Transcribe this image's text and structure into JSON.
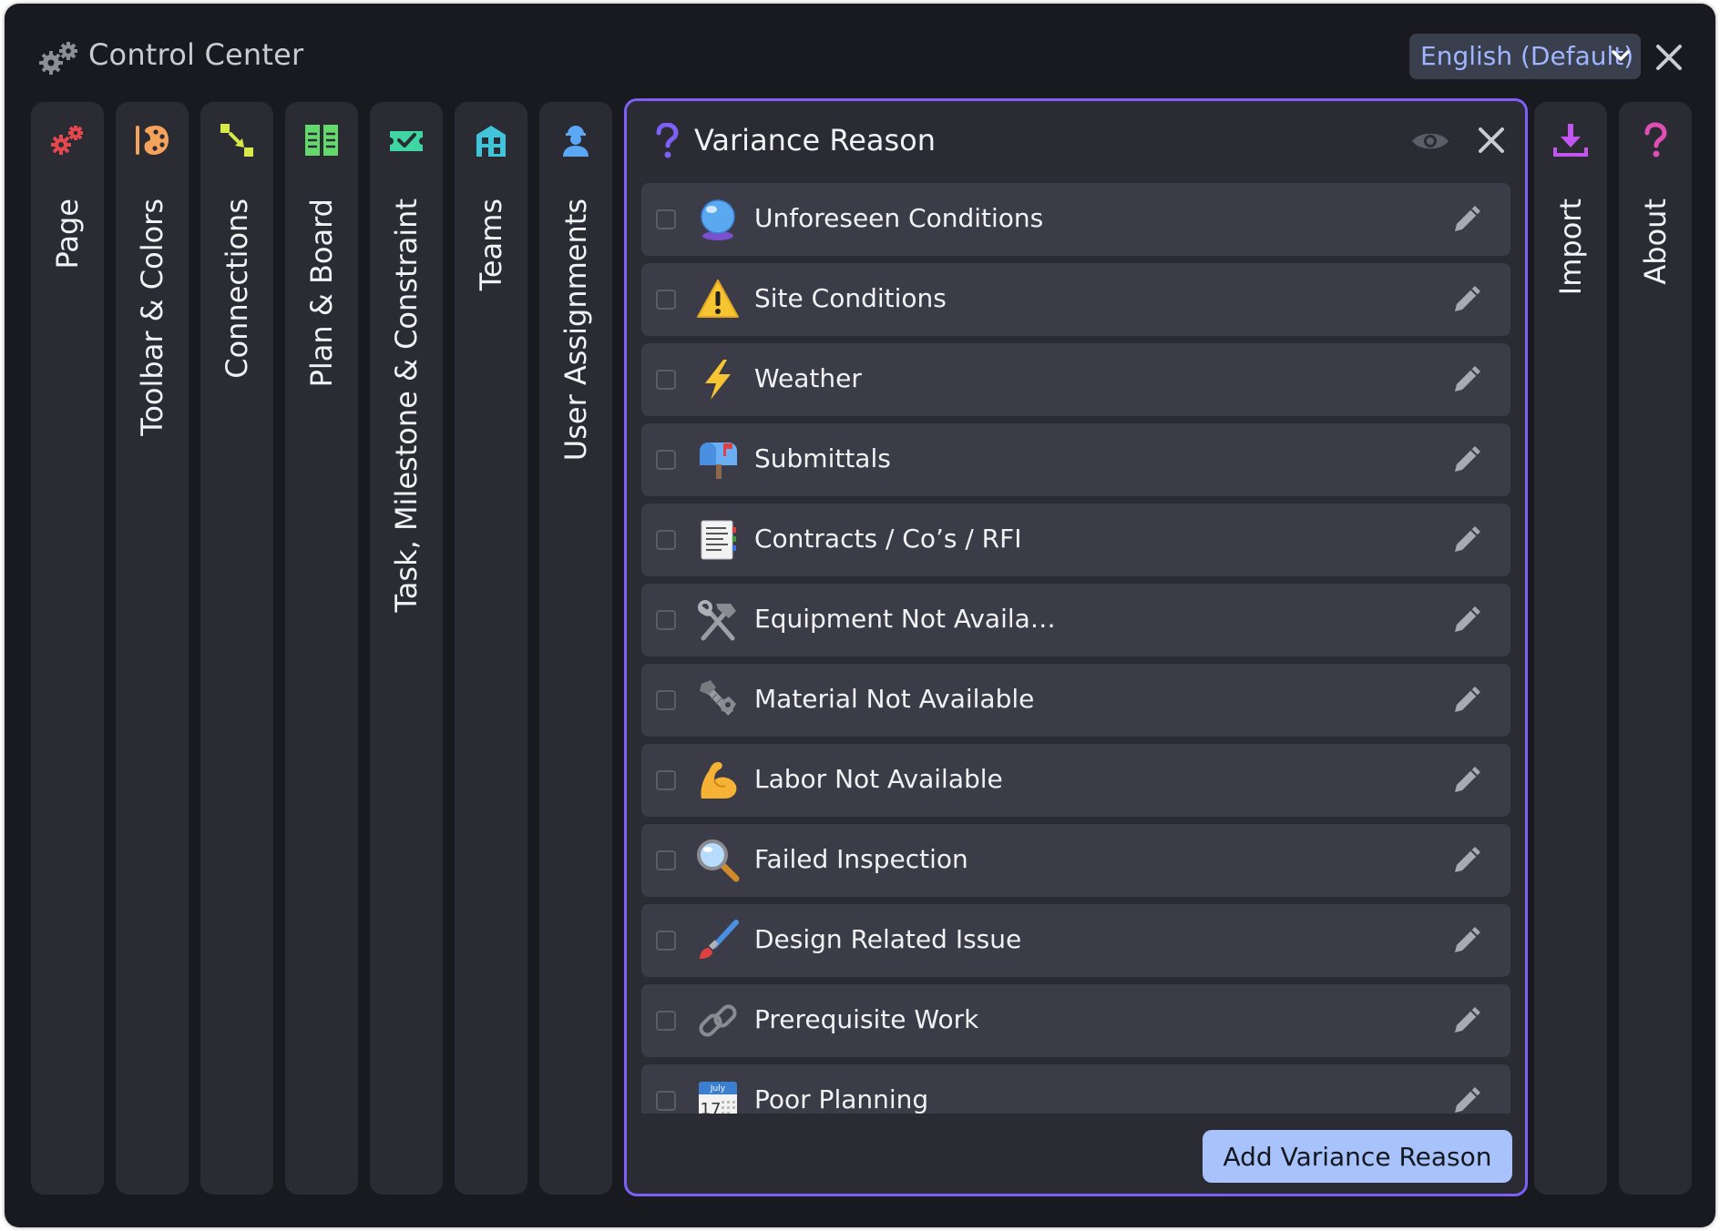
{
  "window": {
    "title": "Control Center",
    "title_icon": "gears-icon"
  },
  "language": {
    "selected": "English (Default)"
  },
  "tabs": [
    {
      "label": "Page",
      "icon": "gears-icon",
      "color": "#e5484d"
    },
    {
      "label": "Toolbar & Colors",
      "icon": "palette-icon",
      "color": "#f5a35c"
    },
    {
      "label": "Connections",
      "icon": "connection-icon",
      "color": "#d6e84a"
    },
    {
      "label": "Plan & Board",
      "icon": "board-icon",
      "color": "#63d96b"
    },
    {
      "label": "Task, Milestone & Constraint",
      "icon": "ticket-icon",
      "color": "#3fd6a3"
    },
    {
      "label": "Teams",
      "icon": "building-icon",
      "color": "#3fc4d9"
    },
    {
      "label": "User Assignments",
      "icon": "worker-icon",
      "color": "#5aa7f5"
    },
    {
      "label": "Import",
      "icon": "download-icon",
      "color": "#c355f0"
    },
    {
      "label": "About",
      "icon": "question-icon",
      "color": "#e04fb3"
    }
  ],
  "panel": {
    "title": "Variance Reason",
    "accent": "#7e5ff7",
    "items": [
      {
        "label": "Unforeseen Conditions",
        "icon": "crystal-ball-icon"
      },
      {
        "label": "Site Conditions",
        "icon": "warning-icon"
      },
      {
        "label": "Weather",
        "icon": "lightning-icon"
      },
      {
        "label": "Submittals",
        "icon": "mailbox-icon"
      },
      {
        "label": "Contracts / Co’s / RFI",
        "icon": "document-icon"
      },
      {
        "label": "Equipment Not Availa…",
        "icon": "tools-icon"
      },
      {
        "label": "Material Not Available",
        "icon": "nut-bolt-icon"
      },
      {
        "label": "Labor Not Available",
        "icon": "flexed-bicep-icon"
      },
      {
        "label": "Failed Inspection",
        "icon": "magnifying-glass-icon"
      },
      {
        "label": "Design Related Issue",
        "icon": "paintbrush-icon"
      },
      {
        "label": "Prerequisite Work",
        "icon": "link-icon"
      },
      {
        "label": "Poor Planning",
        "icon": "calendar-icon",
        "calendar_month": "July",
        "calendar_day": "17"
      }
    ],
    "add_button": "Add Variance Reason"
  }
}
